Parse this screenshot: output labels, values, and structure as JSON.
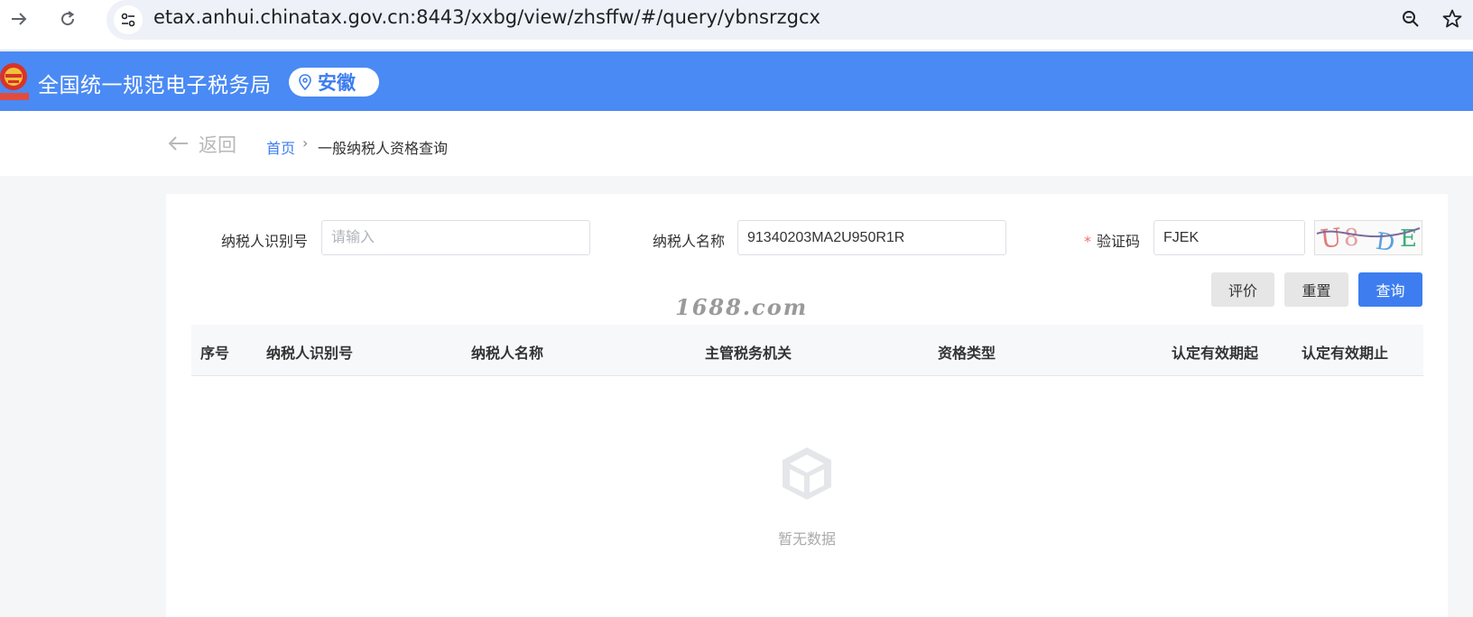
{
  "browser": {
    "url": "etax.anhui.chinatax.gov.cn:8443/xxbg/view/zhsffw/#/query/ybnsrzgcx"
  },
  "header": {
    "title": "全国统一规范电子税务局",
    "region": "安徽"
  },
  "breadcrumb": {
    "back": "返回",
    "home": "首页",
    "separator": "›",
    "current": "一般纳税人资格查询"
  },
  "form": {
    "taxpayer_id_label": "纳税人识别号",
    "taxpayer_id_placeholder": "请输入",
    "taxpayer_name_label": "纳税人名称",
    "taxpayer_name_value": "91340203MA2U950R1R",
    "captcha_required": "*",
    "captcha_label": "验证码",
    "captcha_value": "FJEK",
    "captcha_image_text": "U8DE"
  },
  "buttons": {
    "rate": "评价",
    "reset": "重置",
    "query": "查询"
  },
  "watermark": "1688.com",
  "table": {
    "columns": [
      "序号",
      "纳税人识别号",
      "纳税人名称",
      "主管税务机关",
      "资格类型",
      "认定有效期起",
      "认定有效期止"
    ],
    "empty_text": "暂无数据"
  }
}
